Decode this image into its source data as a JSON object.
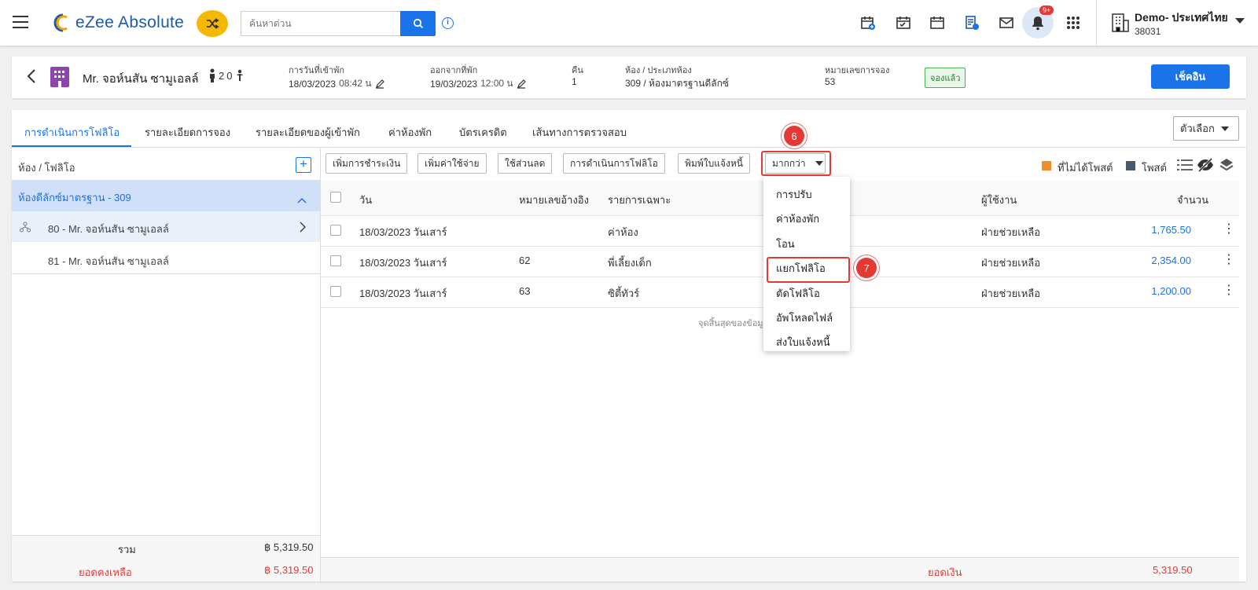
{
  "header": {
    "app_name": "eZee Absolute",
    "search_placeholder": "ค้นหาด่วน",
    "notification_count": "9+",
    "hotel_name": "Demo- ประเทศไทย",
    "hotel_id": "38031"
  },
  "guest": {
    "name": "Mr. จอห์นสัน ซามูเอลล์",
    "adults": "2",
    "children": "0",
    "checkin_label": "การวันที่เข้าพัก",
    "checkin_date": "18/03/2023",
    "checkin_time": "08:42 น",
    "checkout_label": "ออกจากที่พัก",
    "checkout_date": "19/03/2023",
    "checkout_time": "12:00 น",
    "nights_label": "คืน",
    "nights": "1",
    "room_label": "ห้อง / ประเภทห้อง",
    "room": "309 / ห้องมาตรฐานดีลักซ์",
    "booking_label": "หมายเลขการจอง",
    "booking_no": "53",
    "status": "จองแล้ว",
    "checkin_button": "เช็คอิน"
  },
  "tabs": [
    {
      "label": "การดำเนินการโฟลิโอ",
      "active": true
    },
    {
      "label": "รายละเอียดการจอง"
    },
    {
      "label": "รายละเอียดของผู้เข้าพัก"
    },
    {
      "label": "ค่าห้องพัก"
    },
    {
      "label": "บัตรเครดิต"
    },
    {
      "label": "เส้นทางการตรวจสอบ"
    }
  ],
  "options_label": "ตัวเลือก",
  "sidebar": {
    "header": "ห้อง / โฟลิโอ",
    "group": "ห้องดีลักซ์มาตรฐาน - 309",
    "items": [
      "80 - Mr. จอห์นสัน ซามูเอลล์",
      "81 - Mr. จอห์นสัน ซามูเอลล์"
    ],
    "total_label": "รวม",
    "total_value": "฿ 5,319.50",
    "balance_label": "ยอดคงเหลือ",
    "balance_value": "฿ 5,319.50"
  },
  "toolbar": {
    "buttons": [
      "เพิ่มการชำระเงิน",
      "เพิ่มค่าใช้จ่าย",
      "ใช้ส่วนลด",
      "การดำเนินการโฟลิโอ",
      "พิมพ์ใบแจ้งหนี้"
    ],
    "more": "มากกว่า",
    "legend_unposted": "ที่ไม่ได้โพสต์",
    "legend_posted": "โพสต์"
  },
  "table": {
    "columns": [
      "วัน",
      "หมายเลขอ้างอิง",
      "รายการเฉพาะ",
      "ผู้ใช้งาน",
      "จำนวน"
    ],
    "rows": [
      {
        "date": "18/03/2023 วันเสาร์",
        "ref": "",
        "item": "ค่าห้อง",
        "user": "ฝ่ายช่วยเหลือ",
        "amount": "1,765.50"
      },
      {
        "date": "18/03/2023 วันเสาร์",
        "ref": "62",
        "item": "พี่เลี้ยงเด็ก",
        "user": "ฝ่ายช่วยเหลือ",
        "amount": "2,354.00"
      },
      {
        "date": "18/03/2023 วันเสาร์",
        "ref": "63",
        "item": "ซิตี้ทัวร์",
        "user": "ฝ่ายช่วยเหลือ",
        "amount": "1,200.00"
      }
    ],
    "end_text": "จุดสิ้นสุดของข้อมู",
    "footer_label": "ยอดเงิน",
    "footer_value": "5,319.50"
  },
  "more_menu": [
    "การปรับ",
    "ค่าห้องพัก",
    "โอน",
    "แยกโฟลิโอ",
    "ตัดโฟลิโอ",
    "อัพโหลดไฟล์",
    "ส่งใบแจ้งหนี้"
  ],
  "steps": [
    "6",
    "7"
  ],
  "colors": {
    "accent": "#1a73e8",
    "unposted": "#f28c28",
    "posted": "#4a5a6e",
    "danger": "#e53935"
  }
}
